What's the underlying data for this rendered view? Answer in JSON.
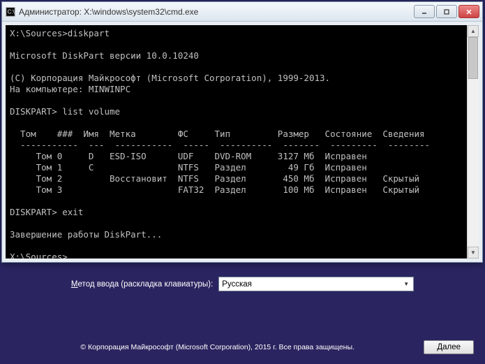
{
  "window": {
    "title": "Администратор: X:\\windows\\system32\\cmd.exe"
  },
  "console": {
    "line_prompt1": "X:\\Sources>diskpart",
    "line_blank": "",
    "line_ver": "Microsoft DiskPart версии 10.0.10240",
    "line_copy": "(C) Корпорация Майкрософт (Microsoft Corporation), 1999-2013.",
    "line_comp": "На компьютере: MINWINPC",
    "line_cmd1": "DISKPART> list volume",
    "line_hdr": "  Том    ###  Имя  Метка        ФС     Тип         Размер   Состояние  Сведения",
    "line_sep": "  -----------  ---  -----------  -----  ----------  -------  ---------  --------",
    "line_v0": "     Том 0     D   ESD-ISO      UDF    DVD-ROM     3127 Мб  Исправен",
    "line_v1": "     Том 1     C                NTFS   Раздел        49 Гб  Исправен",
    "line_v2": "     Том 2         Восстановит  NTFS   Раздел       450 Мб  Исправен   Скрытый",
    "line_v3": "     Том 3                      FAT32  Раздел       100 Мб  Исправен   Скрытый",
    "line_cmd2": "DISKPART> exit",
    "line_exit": "Завершение работы DiskPart...",
    "line_prompt2": "X:\\Sources>"
  },
  "setup": {
    "input_label_prefix": "М",
    "input_label_rest": "етод ввода (раскладка клавиатуры):",
    "dropdown_value": "Русская"
  },
  "footer": {
    "copyright": "© Корпорация Майкрософт (Microsoft Corporation), 2015 г. Все права защищены.",
    "next": "Далее"
  }
}
